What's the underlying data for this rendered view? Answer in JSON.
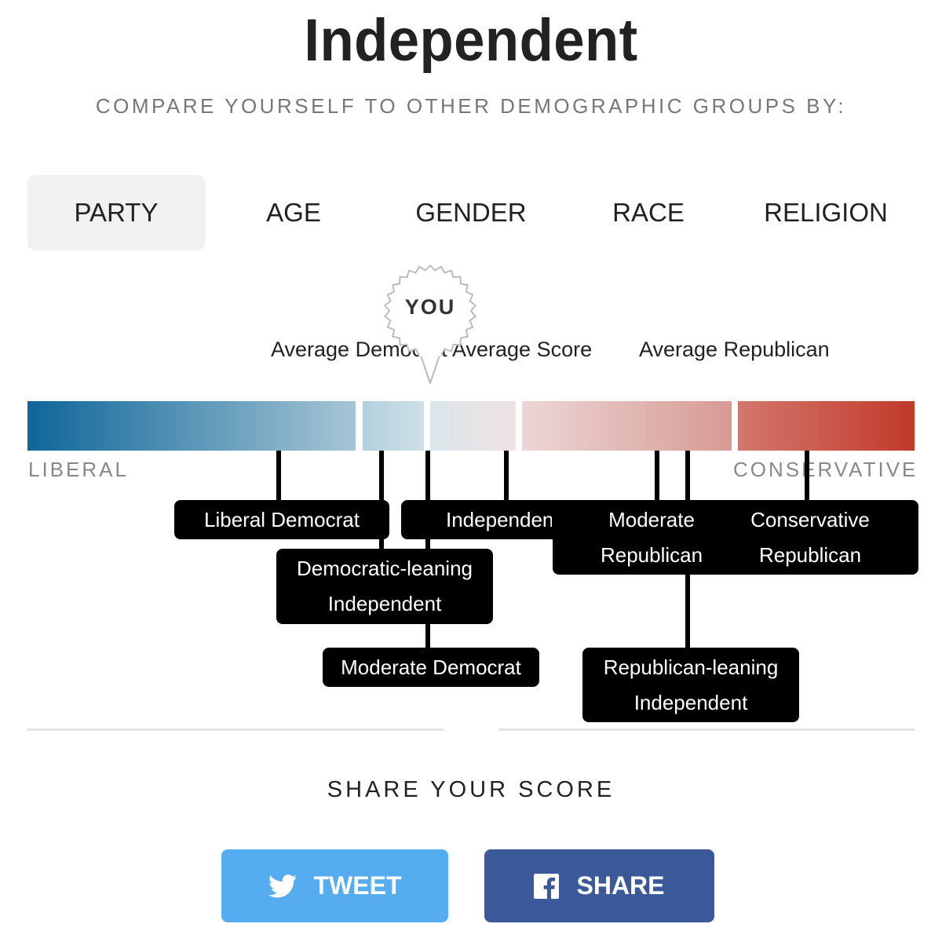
{
  "header": {
    "title": "Independent",
    "subtitle": "COMPARE YOURSELF TO OTHER DEMOGRAPHIC GROUPS BY:"
  },
  "tabs": [
    {
      "label": "PARTY",
      "active": true
    },
    {
      "label": "AGE",
      "active": false
    },
    {
      "label": "GENDER",
      "active": false
    },
    {
      "label": "RACE",
      "active": false
    },
    {
      "label": "RELIGION",
      "active": false
    }
  ],
  "you_marker": {
    "label": "YOU"
  },
  "averages": {
    "democrat": "Average Democrat",
    "score": "Average Score",
    "republican": "Average Republican"
  },
  "scale": {
    "left_label": "LIBERAL",
    "right_label": "CONSERVATIVE",
    "colors": {
      "liberal": "#0e6699",
      "center": "#eeeeee",
      "conservative": "#c13a2b"
    }
  },
  "groups": {
    "liberal_democrat": [
      "Liberal Democrat"
    ],
    "democratic_leaning_independent": [
      "Democratic-leaning",
      "Independent"
    ],
    "moderate_democrat": [
      "Moderate Democrat"
    ],
    "independent": [
      "Independent"
    ],
    "moderate_republican": [
      "Moderate",
      "Republican"
    ],
    "republican_leaning_independent": [
      "Republican-leaning",
      "Independent"
    ],
    "conservative_republican": [
      "Conservative",
      "Republican"
    ]
  },
  "share": {
    "title": "SHARE YOUR SCORE",
    "tweet_label": "TWEET",
    "share_label": "SHARE",
    "tweet_icon": "twitter-bird-icon",
    "share_icon": "facebook-icon",
    "tweet_color": "#55acee",
    "share_color": "#3b5998"
  }
}
